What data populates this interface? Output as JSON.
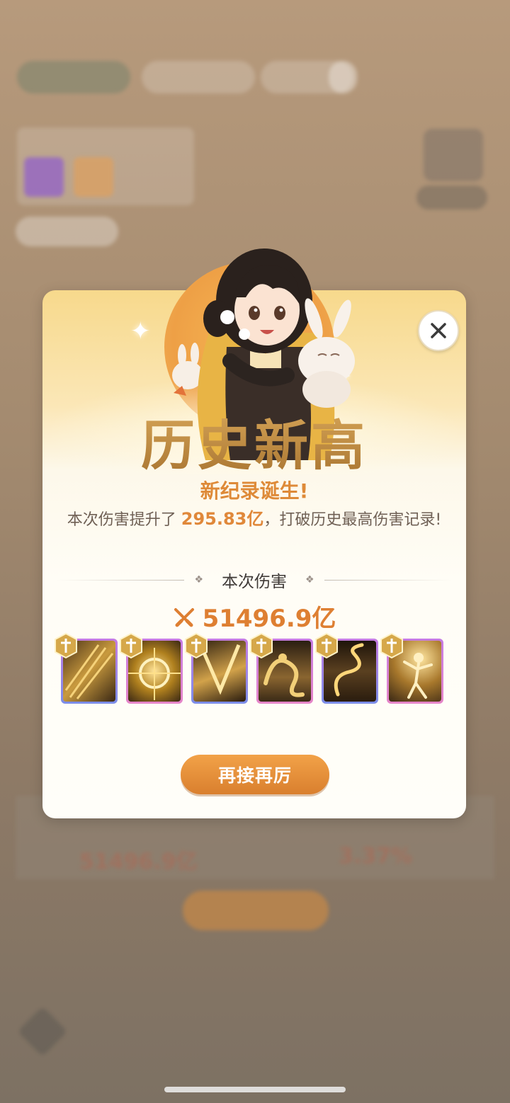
{
  "modal": {
    "headline": "历史新高",
    "subtitle": "新纪录诞生!",
    "desc_prefix": "本次伤害提升了 ",
    "desc_highlight": "295.83亿",
    "desc_suffix": "，打破历史最高伤害记录!",
    "section_label": "本次伤害",
    "damage_value": "51496.9亿",
    "again_button": "再接再厉",
    "skills": [
      {
        "name": "golden-spears",
        "frame": "blue"
      },
      {
        "name": "golden-wheel",
        "frame": "pink"
      },
      {
        "name": "golden-strike",
        "frame": "blue"
      },
      {
        "name": "golden-dragon",
        "frame": "pink"
      },
      {
        "name": "golden-serpent",
        "frame": "blue"
      },
      {
        "name": "golden-dancer",
        "frame": "pink"
      }
    ]
  },
  "background": {
    "value_left": "51496.9亿",
    "value_right": "3.37%"
  },
  "colors": {
    "accent_orange": "#de8a38",
    "headline_gold": "#b7863a",
    "button_orange": "#e28f3a"
  }
}
